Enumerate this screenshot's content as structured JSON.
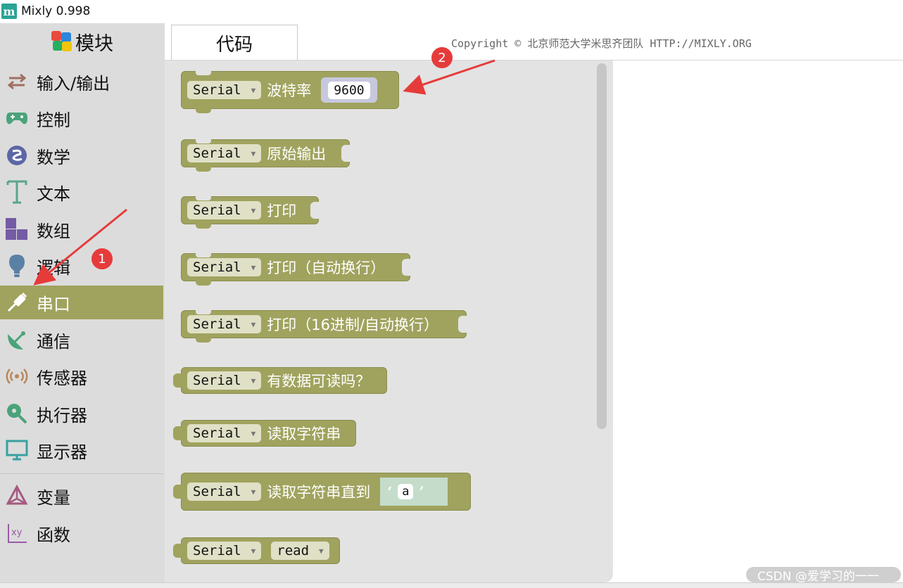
{
  "window": {
    "title": "Mixly 0.998",
    "logo_glyph": "m"
  },
  "sidebar": {
    "header_label": "模块",
    "active_color": "#a0a35e",
    "items": [
      {
        "label": "输入/输出",
        "icon": "arrows-io-icon"
      },
      {
        "label": "控制",
        "icon": "gamepad-icon"
      },
      {
        "label": "数学",
        "icon": "sigma-icon"
      },
      {
        "label": "文本",
        "icon": "text-t-icon"
      },
      {
        "label": "数组",
        "icon": "blocks-icon"
      },
      {
        "label": "逻辑",
        "icon": "bulb-icon"
      },
      {
        "label": "串口",
        "icon": "usb-plug-icon"
      },
      {
        "label": "通信",
        "icon": "satellite-icon"
      },
      {
        "label": "传感器",
        "icon": "sensor-icon"
      },
      {
        "label": "执行器",
        "icon": "actuator-icon"
      },
      {
        "label": "显示器",
        "icon": "monitor-icon"
      },
      {
        "label": "变量",
        "icon": "variable-icon"
      },
      {
        "label": "函数",
        "icon": "function-xy-icon"
      }
    ],
    "active_index": 6
  },
  "tabs": {
    "code_label": "代码"
  },
  "copyright": "Copyright © 北京师范大学米思齐团队 HTTP://MIXLY.ORG",
  "blocks": [
    {
      "dropdown": "Serial",
      "text": "波特率",
      "input_value": "9600"
    },
    {
      "dropdown": "Serial",
      "text": "原始输出"
    },
    {
      "dropdown": "Serial",
      "text": "打印"
    },
    {
      "dropdown": "Serial",
      "text": "打印（自动换行）"
    },
    {
      "dropdown": "Serial",
      "text": "打印（16进制/自动换行）"
    },
    {
      "dropdown": "Serial",
      "text": "有数据可读吗？"
    },
    {
      "dropdown": "Serial",
      "text": "读取字符串"
    },
    {
      "dropdown": "Serial",
      "text": "读取字符串直到",
      "string_value": "a",
      "quote_open": "‘",
      "quote_close": "’"
    },
    {
      "dropdown": "Serial",
      "dropdown2": "read"
    }
  ],
  "dropdown_arrow": "▼",
  "callouts": {
    "badge1": "1",
    "badge2": "2"
  },
  "watermark": "CSDN @爱学习的一一"
}
